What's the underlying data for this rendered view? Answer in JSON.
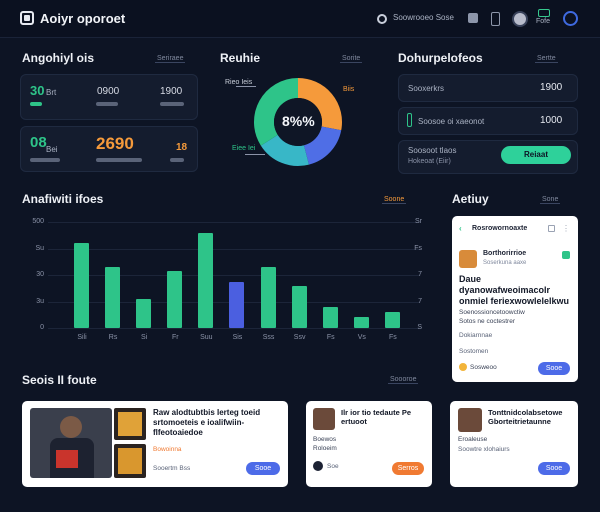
{
  "header": {
    "title": "Aoiyr oporoet",
    "search_text": "Soowrooeo Sose",
    "profile_label": "Fofe"
  },
  "analytics": {
    "title": "Angohiyl ois",
    "filter_label": "Seriraee",
    "row1": {
      "icon_text": "30",
      "label": "Brt",
      "value_a": "0900",
      "value_b": "1900"
    },
    "row2": {
      "icon_text": "08",
      "label": "Bei",
      "value_a": "2690",
      "value_b": "18"
    }
  },
  "donut": {
    "title": "Reuhie",
    "filter_label": "Sorite",
    "center_text": "8%%",
    "label_top": "Rieo Ieis",
    "label_right": "Biis",
    "label_left": "Eiee Iei",
    "segments": [
      {
        "name": "orange",
        "value": 28,
        "color": "#f59a3b"
      },
      {
        "name": "blue",
        "value": 18,
        "color": "#4f6ee6"
      },
      {
        "name": "teal",
        "value": 20,
        "color": "#38b7c7"
      },
      {
        "name": "green",
        "value": 34,
        "color": "#2ec489"
      }
    ]
  },
  "dashboard": {
    "title": "Dohurpelofeos",
    "filter_label": "Sertte",
    "row1_label": "Sooxerkrs",
    "row1_value": "1900",
    "row2_label": "Soosoe oi xaeonot",
    "row2_value": "1000",
    "row3_label": "Soosoot tlaos",
    "row3_sub": "Hokeoat (Eiir)",
    "button": "Reiaat"
  },
  "analytics_chart": {
    "title": "Anafiwiti ifoes",
    "filter_label": "Soone"
  },
  "chart_data": {
    "type": "bar",
    "categories": [
      "Sili",
      "Rs",
      "Si",
      "Fr",
      "Suu",
      "Sis",
      "Sss",
      "Ssv",
      "Fs",
      "Vs",
      "Fs"
    ],
    "values": [
      80,
      58,
      27,
      54,
      90,
      43,
      58,
      40,
      20,
      10,
      15
    ],
    "highlight_index": 5,
    "yticks": [
      "500",
      "Su",
      "30",
      "3u",
      "0"
    ],
    "right_ticks": [
      "Sr",
      "Fs",
      "7",
      "7",
      "S"
    ],
    "ylim": [
      0,
      100
    ]
  },
  "activity": {
    "title": "Aetiuy",
    "filter_label": "Sone",
    "card_title": "Rosrowornoaxte",
    "user_name": "Borthorirrioe",
    "user_sub": "Soserkuna aaxe",
    "headline": "Daue dyanowafweoimacolr onmiel feriexwowlelelkwu",
    "body1": "Soenossioncetoowctiw",
    "body2": "Sotos ne coctestrer",
    "meta1": "Dokiarnnae",
    "meta2": "Sostomen",
    "footer": "Sosweoo",
    "button": "Sooe"
  },
  "posts": {
    "title": "Seois II foute",
    "filter_label": "Soooroe",
    "cards": [
      {
        "title": "Raw alodtubtbis Ierteg toeid srtomoeteis e ioalifwiin-flfeotoaiedoe",
        "link": "Bowoinna",
        "meta": "Sooertm Bss",
        "button": "Sooe"
      },
      {
        "title": "Ilr ior tio tedaute Pe ertuoot",
        "author": "Boewos",
        "sub": "Roloeim",
        "meta": "Soe",
        "button": "Serros"
      },
      {
        "title": "Tonttnidcolabsetowe Gborteitrietaunne",
        "author": "Eroaleuse",
        "meta": "Soowtre xlohaiurs",
        "button": "Sooe"
      }
    ]
  },
  "colors": {
    "background": "#0d1424",
    "card": "#141c2e",
    "bar_green": "#2ec489",
    "bar_blue": "#4b5fe0",
    "accent_orange": "#f59a3b",
    "accent_green": "#2ed19a"
  }
}
